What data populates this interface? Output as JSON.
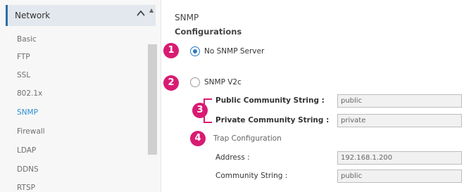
{
  "sidebar": {
    "header": "Network",
    "items": [
      {
        "label": "Basic",
        "active": false
      },
      {
        "label": "FTP",
        "active": false
      },
      {
        "label": "SSL",
        "active": false
      },
      {
        "label": "802.1x",
        "active": false
      },
      {
        "label": "SNMP",
        "active": true
      },
      {
        "label": "Firewall",
        "active": false
      },
      {
        "label": "LDAP",
        "active": false
      },
      {
        "label": "DDNS",
        "active": false
      },
      {
        "label": "RTSP",
        "active": false
      }
    ]
  },
  "main": {
    "title": "SNMP",
    "subtitle": "Configurations",
    "options": {
      "no_snmp": "No SNMP Server",
      "snmp_v2c": "SNMP V2c",
      "selected": "no_snmp"
    },
    "fields": {
      "public_label": "Public Community String :",
      "public_value": "public",
      "private_label": "Private Community String :",
      "private_value": "private",
      "trap_label": "Trap Configuration",
      "address_label": "Address :",
      "address_value": "192.168.1.200",
      "community_label": "Community String :",
      "community_value": "public"
    },
    "callouts": [
      "1",
      "2",
      "3",
      "4"
    ]
  },
  "colors": {
    "callout": "#d81b72",
    "accent": "#2b7bc1",
    "active_item": "#2f8fd1"
  }
}
